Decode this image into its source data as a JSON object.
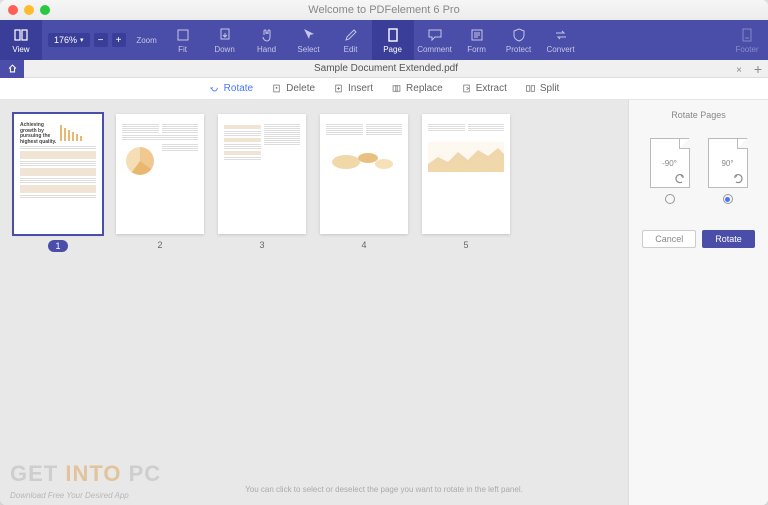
{
  "window": {
    "title": "Welcome to PDFelement 6 Pro"
  },
  "toolbar": {
    "view": "View",
    "zoom": "Zoom",
    "zoom_value": "176%",
    "fit": "Fit",
    "down": "Down",
    "hand": "Hand",
    "select": "Select",
    "edit": "Edit",
    "page": "Page",
    "comment": "Comment",
    "form": "Form",
    "protect": "Protect",
    "convert": "Convert",
    "footer": "Footer"
  },
  "tab": {
    "name": "Sample Document Extended.pdf"
  },
  "subtoolbar": {
    "rotate": "Rotate",
    "delete": "Delete",
    "insert": "Insert",
    "replace": "Replace",
    "extract": "Extract",
    "split": "Split"
  },
  "pages": [
    {
      "num": "1",
      "selected": true,
      "title": "Achieving growth by pursuing the highest quality."
    },
    {
      "num": "2",
      "selected": false
    },
    {
      "num": "3",
      "selected": false
    },
    {
      "num": "4",
      "selected": false
    },
    {
      "num": "5",
      "selected": false
    }
  ],
  "sidebar": {
    "title": "Rotate Pages",
    "neg90": "-90°",
    "pos90": "90°",
    "cancel": "Cancel",
    "rotate": "Rotate",
    "hint": "You can click to select or deselect the page you want to rotate in the left panel."
  },
  "watermark": {
    "t1": "GET ",
    "t2": "INTO ",
    "t3": "PC",
    "sub": "Download Free Your Desired App"
  }
}
